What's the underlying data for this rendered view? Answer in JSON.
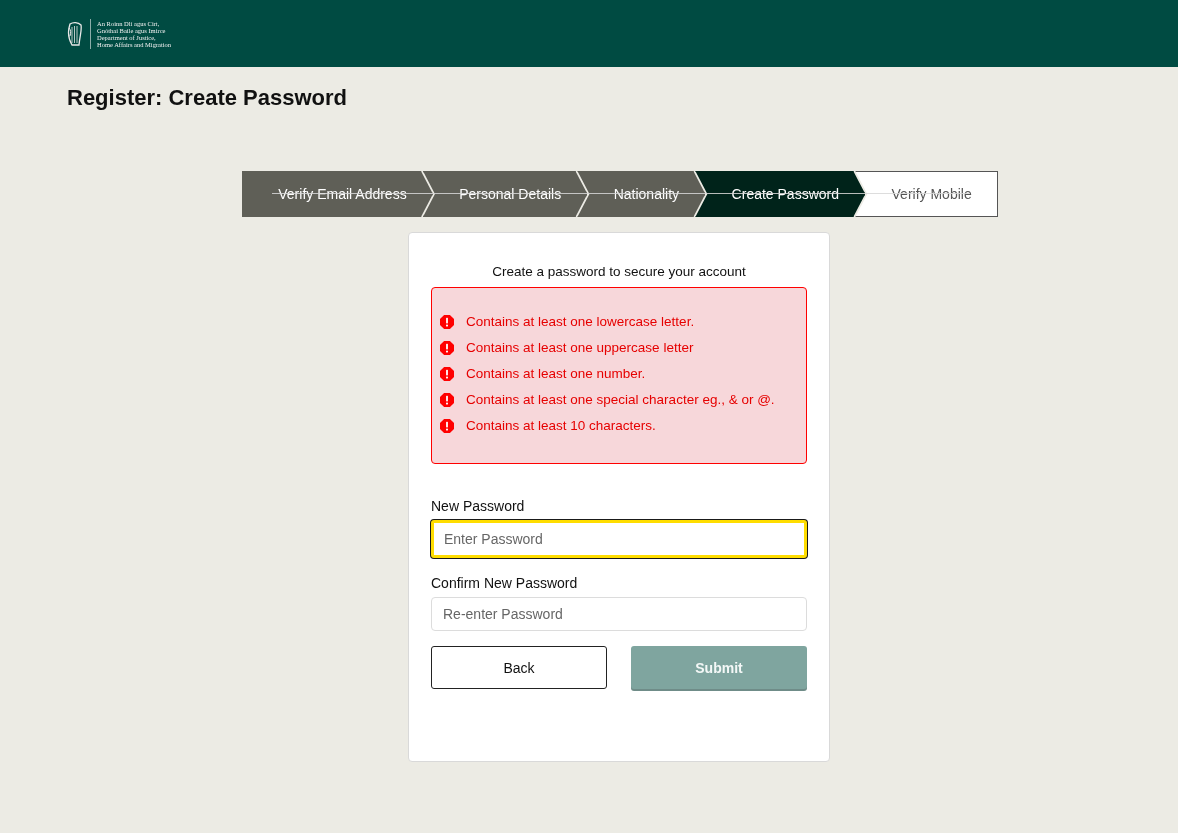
{
  "header": {
    "logo_lines": [
      "An Roinn Dlí agus Cirt,",
      "Gnóthaí Baile agus Imirce",
      "Department of Justice,",
      "Home Affairs and Migration"
    ]
  },
  "page_title": "Register: Create Password",
  "steps": [
    {
      "label": "Verify Email Address",
      "completed": true,
      "selected": false
    },
    {
      "label": "Personal Details",
      "completed": true,
      "selected": false
    },
    {
      "label": "Nationality",
      "completed": true,
      "selected": false
    },
    {
      "label": "Create Password",
      "completed": false,
      "selected": true
    },
    {
      "label": "Verify Mobile",
      "completed": false,
      "selected": false
    }
  ],
  "form": {
    "intro": "Create a password to secure your account",
    "requirements": [
      {
        "text": "Contains at least one lowercase letter.",
        "met": false
      },
      {
        "text": "Contains at least one uppercase letter",
        "met": false
      },
      {
        "text": "Contains at least one number.",
        "met": false
      },
      {
        "text": "Contains at least one special character eg., & or @.",
        "met": false
      },
      {
        "text": "Contains at least 10 characters.",
        "met": false
      }
    ],
    "fields": [
      {
        "label": "New Password",
        "placeholder": "Enter Password",
        "focused": true
      },
      {
        "label": "Confirm New Password",
        "placeholder": "Re-enter Password",
        "focused": false
      }
    ],
    "buttons": [
      {
        "label": "Back",
        "kind": "secondary",
        "disabled": false
      },
      {
        "label": "Submit",
        "kind": "primary",
        "disabled": true
      }
    ]
  }
}
